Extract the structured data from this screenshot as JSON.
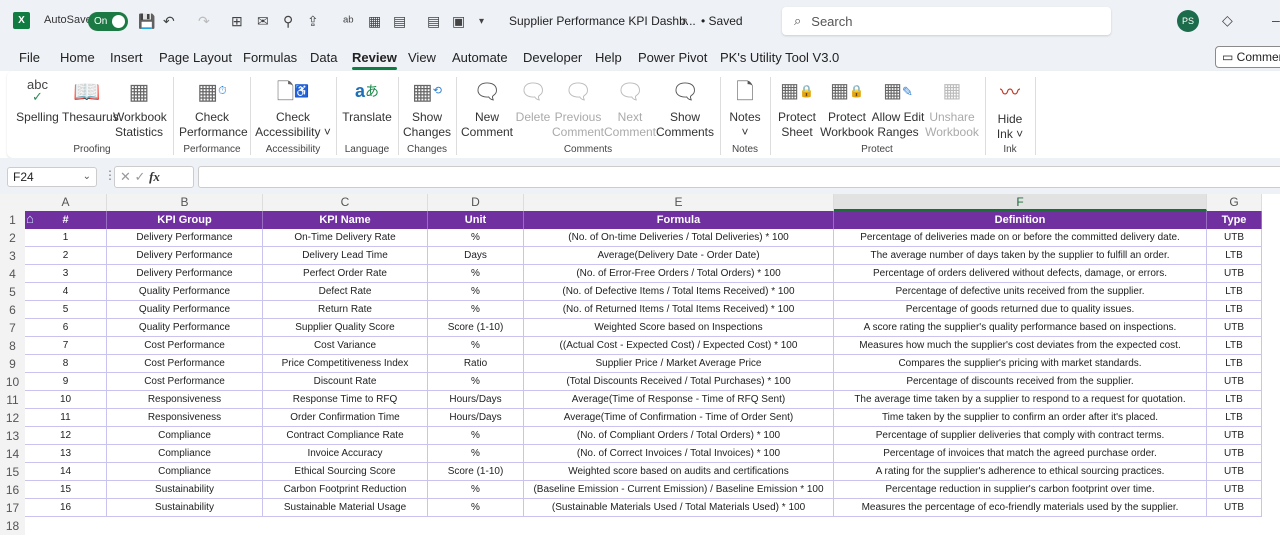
{
  "titlebar": {
    "autosave_label": "AutoSave",
    "autosave_state": "On",
    "doc_title": "Supplier Performance KPI Dashb...",
    "save_status": "• Saved",
    "search_placeholder": "Search",
    "user_initials": "PS"
  },
  "menu": {
    "items": [
      "File",
      "Home",
      "Insert",
      "Page Layout",
      "Formulas",
      "Data",
      "Review",
      "View",
      "Automate",
      "Developer",
      "Help",
      "Power Pivot",
      "PK's Utility Tool V3.0"
    ],
    "active": "Review",
    "comments_button": "Commen"
  },
  "ribbon": {
    "buttons": {
      "spelling": "Spelling",
      "thesaurus": "Thesaurus",
      "workbook_stats_1": "Workbook",
      "workbook_stats_2": "Statistics",
      "check_perf_1": "Check",
      "check_perf_2": "Performance",
      "check_access_1": "Check",
      "check_access_2": "Accessibility ˅",
      "translate": "Translate",
      "show_changes_1": "Show",
      "show_changes_2": "Changes",
      "new_comment_1": "New",
      "new_comment_2": "Comment",
      "delete": "Delete",
      "prev_comment_1": "Previous",
      "prev_comment_2": "Comment",
      "next_comment_1": "Next",
      "next_comment_2": "Comment",
      "show_comments_1": "Show",
      "show_comments_2": "Comments",
      "notes_1": "Notes",
      "notes_2": "˅",
      "protect_sheet_1": "Protect",
      "protect_sheet_2": "Sheet",
      "protect_wb_1": "Protect",
      "protect_wb_2": "Workbook",
      "allow_edit_1": "Allow Edit",
      "allow_edit_2": "Ranges",
      "unshare_1": "Unshare",
      "unshare_2": "Workbook",
      "hide_ink_1": "Hide",
      "hide_ink_2": "Ink ˅"
    },
    "groups": {
      "proofing": "Proofing",
      "performance": "Performance",
      "accessibility": "Accessibility",
      "language": "Language",
      "changes": "Changes",
      "comments": "Comments",
      "notes": "Notes",
      "protect": "Protect",
      "ink": "Ink"
    }
  },
  "formula_bar": {
    "name_box": "F24",
    "formula": ""
  },
  "sheet": {
    "columns": [
      "A",
      "B",
      "C",
      "D",
      "E",
      "F",
      "G"
    ],
    "selected_column": "F",
    "headers": [
      "#",
      "KPI Group",
      "KPI Name",
      "Unit",
      "Formula",
      "Definition",
      "Type"
    ],
    "rows": [
      [
        "1",
        "Delivery Performance",
        "On-Time Delivery Rate",
        "%",
        "(No. of On-time Deliveries / Total Deliveries) * 100",
        "Percentage of deliveries made on or before the committed delivery date.",
        "UTB"
      ],
      [
        "2",
        "Delivery Performance",
        "Delivery Lead Time",
        "Days",
        "Average(Delivery Date - Order Date)",
        "The average number of days taken by the supplier to fulfill an order.",
        "LTB"
      ],
      [
        "3",
        "Delivery Performance",
        "Perfect Order Rate",
        "%",
        "(No. of Error-Free Orders / Total Orders) * 100",
        "Percentage of orders delivered without defects, damage, or errors.",
        "UTB"
      ],
      [
        "4",
        "Quality Performance",
        "Defect Rate",
        "%",
        "(No. of Defective Items / Total Items Received) * 100",
        "Percentage of defective units received from the supplier.",
        "LTB"
      ],
      [
        "5",
        "Quality Performance",
        "Return Rate",
        "%",
        "(No. of Returned Items / Total Items Received) * 100",
        "Percentage of goods returned due to quality issues.",
        "LTB"
      ],
      [
        "6",
        "Quality Performance",
        "Supplier Quality Score",
        "Score (1-10)",
        "Weighted Score based on Inspections",
        "A score rating the supplier's quality performance based on inspections.",
        "UTB"
      ],
      [
        "7",
        "Cost Performance",
        "Cost Variance",
        "%",
        "((Actual Cost - Expected Cost) / Expected Cost) * 100",
        "Measures how much the supplier's cost deviates from the expected cost.",
        "LTB"
      ],
      [
        "8",
        "Cost Performance",
        "Price Competitiveness Index",
        "Ratio",
        "Supplier Price / Market Average Price",
        "Compares the supplier's pricing with market standards.",
        "LTB"
      ],
      [
        "9",
        "Cost Performance",
        "Discount Rate",
        "%",
        "(Total Discounts Received / Total Purchases) * 100",
        "Percentage of discounts received from the supplier.",
        "UTB"
      ],
      [
        "10",
        "Responsiveness",
        "Response Time to RFQ",
        "Hours/Days",
        "Average(Time of Response - Time of RFQ Sent)",
        "The average time taken by a supplier to respond to a request for quotation.",
        "LTB"
      ],
      [
        "11",
        "Responsiveness",
        "Order Confirmation Time",
        "Hours/Days",
        "Average(Time of Confirmation - Time of Order Sent)",
        "Time taken by the supplier to confirm an order after it's placed.",
        "LTB"
      ],
      [
        "12",
        "Compliance",
        "Contract Compliance Rate",
        "%",
        "(No. of Compliant Orders / Total Orders) * 100",
        "Percentage of supplier deliveries that comply with contract terms.",
        "UTB"
      ],
      [
        "13",
        "Compliance",
        "Invoice Accuracy",
        "%",
        "(No. of Correct Invoices / Total Invoices) * 100",
        "Percentage of invoices that match the agreed purchase order.",
        "UTB"
      ],
      [
        "14",
        "Compliance",
        "Ethical Sourcing Score",
        "Score (1-10)",
        "Weighted score based on audits and certifications",
        "A rating for the supplier's adherence to ethical sourcing practices.",
        "UTB"
      ],
      [
        "15",
        "Sustainability",
        "Carbon Footprint Reduction",
        "%",
        "(Baseline Emission - Current Emission) / Baseline Emission * 100",
        "Percentage reduction in supplier's carbon footprint over time.",
        "UTB"
      ],
      [
        "16",
        "Sustainability",
        "Sustainable Material Usage",
        "%",
        "(Sustainable Materials Used / Total Materials Used) * 100",
        "Measures the percentage of eco-friendly materials used by the supplier.",
        "UTB"
      ]
    ],
    "row_numbers": [
      "1",
      "2",
      "3",
      "4",
      "5",
      "6",
      "7",
      "8",
      "9",
      "10",
      "11",
      "12",
      "13",
      "14",
      "15",
      "16",
      "17",
      "18"
    ]
  },
  "colors": {
    "header_fill": "#7030a0",
    "accent_green": "#107c41",
    "grid_line": "#c9c3ef"
  }
}
